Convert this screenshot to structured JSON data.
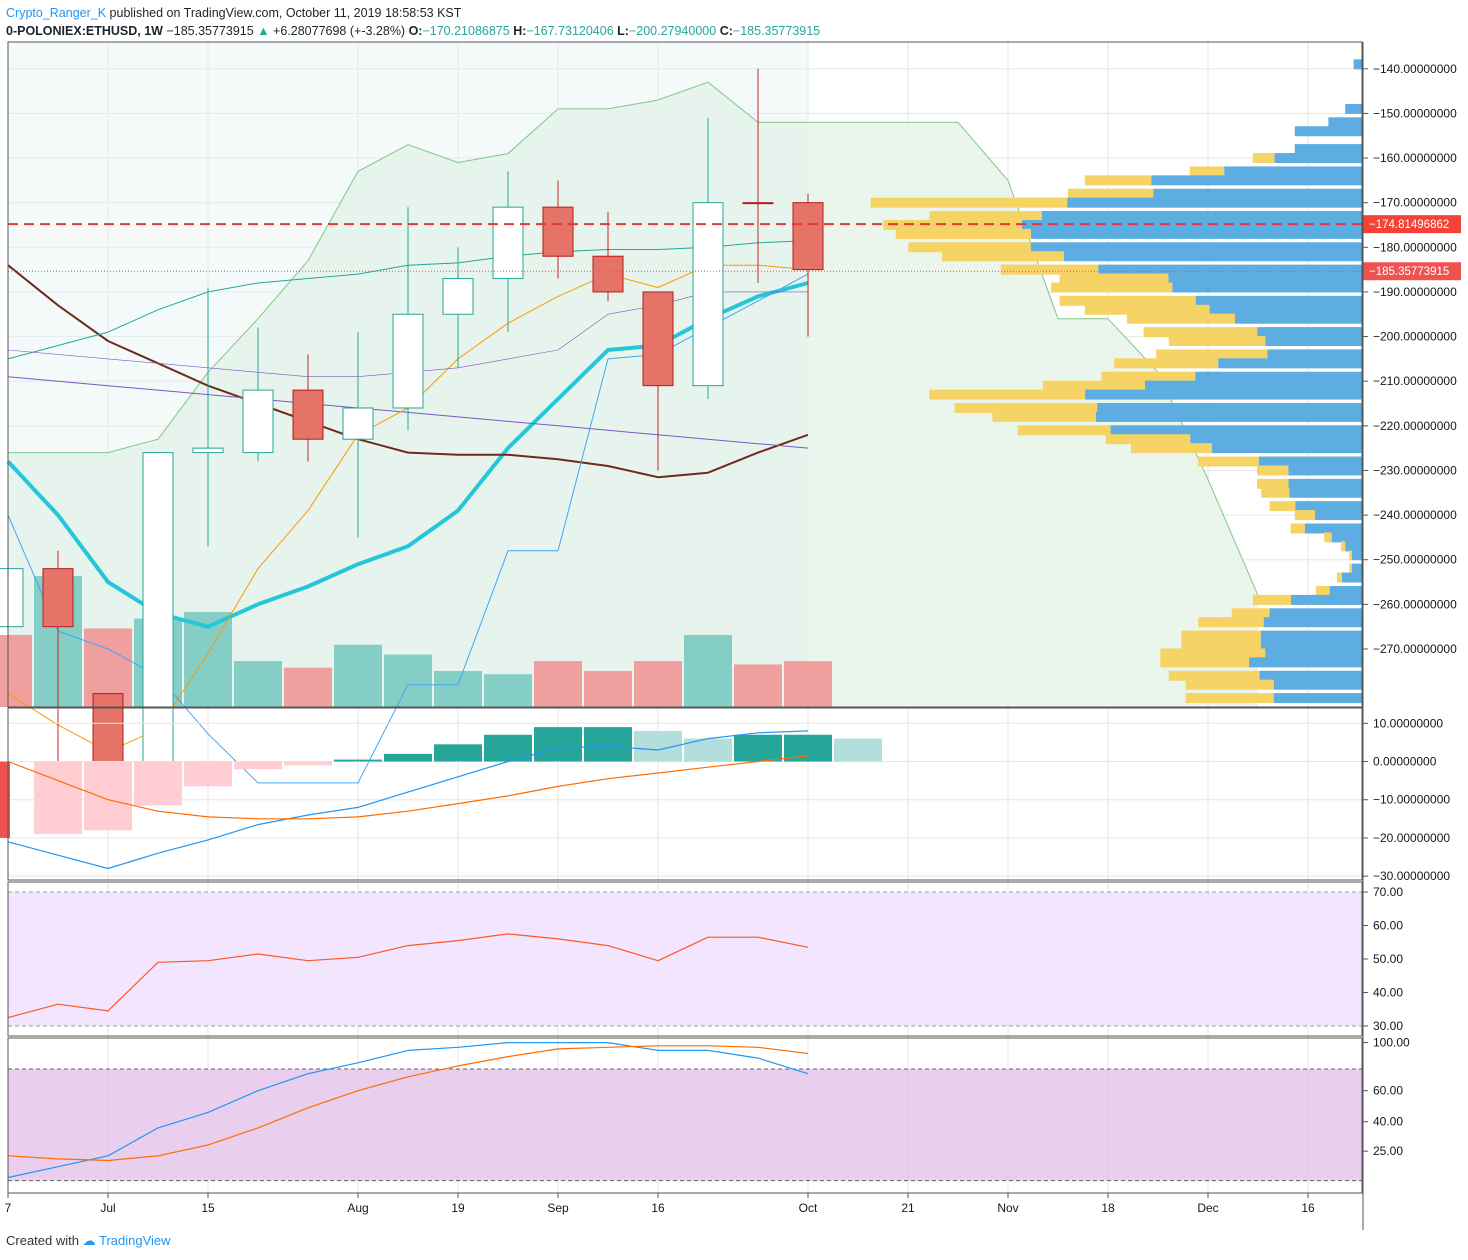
{
  "header": {
    "author": "Crypto_Ranger_K",
    "published": "published on TradingView.com, October 11, 2019 18:58:53 KST",
    "symbol": "0-POLONIEX:ETHUSD, 1W",
    "last": "−185.35773915",
    "change_arrow": "▲",
    "change": "+6.28077698 (+-3.28%)",
    "o_label": "O:",
    "o_val": "−170.21086875",
    "h_label": "H:",
    "h_val": "−167.73120406",
    "l_label": "L:",
    "l_val": "−200.27940000",
    "c_label": "C:",
    "c_val": "−185.35773915"
  },
  "footer": {
    "created_with": "Created with",
    "brand": "TradingView"
  },
  "colors": {
    "up": "#26a69a",
    "down": "#ef5350",
    "ema": "#26c6da",
    "grid": "#e6e6e6"
  },
  "chart_data": [
    {
      "type": "candlestick",
      "panel": "price",
      "x_ticks": [
        "7",
        "Jul",
        "15",
        "Aug",
        "19",
        "Sep",
        "16",
        "Oct",
        "21",
        "Nov",
        "18",
        "Dec",
        "16"
      ],
      "y_ticks": [
        "−140.00000000",
        "−150.00000000",
        "−160.00000000",
        "−170.00000000",
        "−180.00000000",
        "−190.00000000",
        "−200.00000000",
        "−210.00000000",
        "−220.00000000",
        "−230.00000000",
        "−240.00000000",
        "−250.00000000",
        "−260.00000000",
        "−270.00000000"
      ],
      "ylim": [
        -283,
        -134
      ],
      "candles": [
        {
          "o": -265,
          "h": -276,
          "l": -300,
          "c": -252
        },
        {
          "o": -252,
          "h": -248,
          "l": -300,
          "c": -265
        },
        {
          "o": -280,
          "h": -280,
          "l": -300,
          "c": -300
        },
        {
          "o": -297,
          "h": -252,
          "l": -300,
          "c": -226
        },
        {
          "o": -226,
          "h": -189,
          "l": -247,
          "c": -225
        },
        {
          "o": -226,
          "h": -198,
          "l": -228,
          "c": -212
        },
        {
          "o": -212,
          "h": -204,
          "l": -228,
          "c": -223
        },
        {
          "o": -223,
          "h": -199,
          "l": -245,
          "c": -216
        },
        {
          "o": -216,
          "h": -171,
          "l": -221,
          "c": -195
        },
        {
          "o": -195,
          "h": -180,
          "l": -207,
          "c": -187
        },
        {
          "o": -187,
          "h": -163,
          "l": -199,
          "c": -171
        },
        {
          "o": -171,
          "h": -165,
          "l": -187,
          "c": -182
        },
        {
          "o": -182,
          "h": -172,
          "l": -192,
          "c": -190
        },
        {
          "o": -190,
          "h": -190,
          "l": -230,
          "c": -211
        },
        {
          "o": -211,
          "h": -151,
          "l": -214,
          "c": -170
        },
        {
          "o": -170,
          "h": -140,
          "l": -188,
          "c": -170
        },
        {
          "o": -170,
          "h": -168,
          "l": -200,
          "c": -185
        }
      ],
      "horizontal_lines": [
        {
          "value": -174.81496862,
          "label": "−174.81496862",
          "style": "dashed",
          "color": "#e53935"
        },
        {
          "value": -185.35773915,
          "label": "−185.35773915",
          "style": "dotted",
          "color": "#ef5350"
        }
      ],
      "series": [
        {
          "color": "#26c6da",
          "values": [
            -228,
            -240,
            -255,
            -262,
            -265,
            -260,
            -256,
            -251,
            -247,
            -239,
            -225,
            -214,
            -203,
            -202,
            -196,
            -191,
            -188
          ]
        },
        {
          "color": "#6d2b1e",
          "values": [
            -184,
            -193,
            -201,
            -206,
            -211,
            -215,
            -219,
            -223,
            -226,
            -226.5,
            -226.5,
            -227.5,
            -229,
            -231.5,
            -230.5,
            -226,
            -222
          ]
        },
        {
          "color": "#7e57c2",
          "values": [
            -209,
            -210,
            -211,
            -212,
            -213,
            -214,
            -215,
            -216,
            -217,
            -218,
            -219,
            -220,
            -221,
            -222,
            -223,
            -224,
            -225
          ]
        },
        {
          "color": "#ff9800",
          "values": [
            -280,
            -287,
            -293,
            -288,
            -271,
            -252,
            -239,
            -222,
            -216,
            -205,
            -197,
            -191,
            -186,
            -189,
            -184,
            -184,
            -185
          ]
        },
        {
          "color": "#26a69a",
          "values": [
            -205,
            -202,
            -199,
            -194,
            -190,
            -188,
            -187,
            -186,
            -184,
            -183.5,
            -182,
            -181,
            -180.5,
            -180.5,
            -180,
            -179,
            -178.5
          ]
        },
        {
          "color": "#42a5f5",
          "values": [
            -240,
            -266,
            -270,
            -276,
            -289,
            -300,
            -300,
            -300,
            -278,
            -278,
            -248,
            -248,
            -205,
            -204,
            -198,
            -192,
            -186
          ]
        }
      ],
      "volume": [
        {
          "v": 0.22,
          "up": false
        },
        {
          "v": 0.4,
          "up": true
        },
        {
          "v": 0.24,
          "up": false
        },
        {
          "v": 0.27,
          "up": true
        },
        {
          "v": 0.29,
          "up": true
        },
        {
          "v": 0.14,
          "up": true
        },
        {
          "v": 0.12,
          "up": false
        },
        {
          "v": 0.19,
          "up": true
        },
        {
          "v": 0.16,
          "up": true
        },
        {
          "v": 0.11,
          "up": true
        },
        {
          "v": 0.1,
          "up": true
        },
        {
          "v": 0.14,
          "up": false
        },
        {
          "v": 0.11,
          "up": false
        },
        {
          "v": 0.14,
          "up": false
        },
        {
          "v": 0.22,
          "up": true
        },
        {
          "v": 0.13,
          "up": false
        },
        {
          "v": 0.14,
          "up": false
        }
      ],
      "volume_profile": [
        {
          "price": -139,
          "total": 0.02,
          "up_share": 0.0
        },
        {
          "price": -149,
          "total": 0.04,
          "up_share": 0.0
        },
        {
          "price": -152,
          "total": 0.08,
          "up_share": 0.0
        },
        {
          "price": -154,
          "total": 0.16,
          "up_share": 0.0
        },
        {
          "price": -158,
          "total": 0.16,
          "up_share": 0.0
        },
        {
          "price": -160,
          "total": 0.26,
          "up_share": 0.2
        },
        {
          "price": -163,
          "total": 0.41,
          "up_share": 0.2
        },
        {
          "price": -165,
          "total": 0.66,
          "up_share": 0.24
        },
        {
          "price": -168,
          "total": 0.7,
          "up_share": 0.29
        },
        {
          "price": -170,
          "total": 1.17,
          "up_share": 0.4
        },
        {
          "price": -173,
          "total": 1.03,
          "up_share": 0.26
        },
        {
          "price": -175,
          "total": 1.14,
          "up_share": 0.29
        },
        {
          "price": -177,
          "total": 1.11,
          "up_share": 0.29
        },
        {
          "price": -180,
          "total": 1.08,
          "up_share": 0.27
        },
        {
          "price": -182,
          "total": 1.0,
          "up_share": 0.29
        },
        {
          "price": -185,
          "total": 0.86,
          "up_share": 0.27
        },
        {
          "price": -187,
          "total": 0.72,
          "up_share": 0.36
        },
        {
          "price": -189,
          "total": 0.74,
          "up_share": 0.39
        },
        {
          "price": -192,
          "total": 0.72,
          "up_share": 0.45
        },
        {
          "price": -194,
          "total": 0.66,
          "up_share": 0.45
        },
        {
          "price": -196,
          "total": 0.56,
          "up_share": 0.46
        },
        {
          "price": -199,
          "total": 0.52,
          "up_share": 0.52
        },
        {
          "price": -201,
          "total": 0.46,
          "up_share": 0.5
        },
        {
          "price": -204,
          "total": 0.49,
          "up_share": 0.54
        },
        {
          "price": -206,
          "total": 0.59,
          "up_share": 0.42
        },
        {
          "price": -209,
          "total": 0.62,
          "up_share": 0.36
        },
        {
          "price": -211,
          "total": 0.76,
          "up_share": 0.32
        },
        {
          "price": -213,
          "total": 1.03,
          "up_share": 0.36
        },
        {
          "price": -216,
          "total": 0.97,
          "up_share": 0.35
        },
        {
          "price": -218,
          "total": 0.88,
          "up_share": 0.28
        },
        {
          "price": -221,
          "total": 0.82,
          "up_share": 0.27
        },
        {
          "price": -223,
          "total": 0.61,
          "up_share": 0.33
        },
        {
          "price": -225,
          "total": 0.55,
          "up_share": 0.35
        },
        {
          "price": -228,
          "total": 0.39,
          "up_share": 0.37
        },
        {
          "price": -230,
          "total": 0.25,
          "up_share": 0.3
        },
        {
          "price": -233,
          "total": 0.25,
          "up_share": 0.3
        },
        {
          "price": -235,
          "total": 0.24,
          "up_share": 0.28
        },
        {
          "price": -238,
          "total": 0.22,
          "up_share": 0.28
        },
        {
          "price": -240,
          "total": 0.16,
          "up_share": 0.3
        },
        {
          "price": -243,
          "total": 0.17,
          "up_share": 0.2
        },
        {
          "price": -245,
          "total": 0.09,
          "up_share": 0.2
        },
        {
          "price": -247,
          "total": 0.05,
          "up_share": 0.2
        },
        {
          "price": -249,
          "total": 0.03,
          "up_share": 0.2
        },
        {
          "price": -252,
          "total": 0.03,
          "up_share": 0.2
        },
        {
          "price": -254,
          "total": 0.06,
          "up_share": 0.2
        },
        {
          "price": -257,
          "total": 0.11,
          "up_share": 0.3
        },
        {
          "price": -259,
          "total": 0.26,
          "up_share": 0.35
        },
        {
          "price": -262,
          "total": 0.31,
          "up_share": 0.29
        },
        {
          "price": -264,
          "total": 0.39,
          "up_share": 0.4
        },
        {
          "price": -267,
          "total": 0.43,
          "up_share": 0.44
        },
        {
          "price": -269,
          "total": 0.43,
          "up_share": 0.44
        },
        {
          "price": -271,
          "total": 0.48,
          "up_share": 0.52
        },
        {
          "price": -273,
          "total": 0.48,
          "up_share": 0.44
        },
        {
          "price": -276,
          "total": 0.46,
          "up_share": 0.47
        },
        {
          "price": -278,
          "total": 0.42,
          "up_share": 0.5
        },
        {
          "price": -281,
          "total": 0.42,
          "up_share": 0.5
        }
      ]
    },
    {
      "type": "bar",
      "panel": "macd",
      "y_ticks": [
        "10.00000000",
        "0.00000000",
        "−10.00000000",
        "−20.00000000",
        "−30.00000000"
      ],
      "ylim": [
        -31,
        14
      ],
      "histogram": [
        -20,
        -19,
        -18,
        -11.5,
        -6.5,
        -2,
        -1,
        0.5,
        2,
        4.5,
        7,
        9,
        9,
        8,
        6,
        7,
        7,
        6
      ],
      "series": [
        {
          "color": "#2196f3",
          "values": [
            -21,
            -24.5,
            -28,
            -24,
            -20.5,
            -16.5,
            -14,
            -12,
            -8,
            -4,
            0,
            3.5,
            4,
            3,
            6,
            7.5,
            8
          ]
        },
        {
          "color": "#ff6d00",
          "values": [
            0,
            -5,
            -10,
            -13,
            -14.5,
            -15,
            -15,
            -14.5,
            -13,
            -11,
            -9,
            -6.5,
            -4.5,
            -3,
            -1.5,
            0,
            1.5
          ]
        }
      ]
    },
    {
      "type": "line",
      "panel": "rsi",
      "y_ticks": [
        "70.00",
        "60.00",
        "50.00",
        "40.00",
        "30.00"
      ],
      "ylim": [
        27,
        73
      ],
      "band": [
        30,
        70
      ],
      "values": [
        32.5,
        36.5,
        34.5,
        49,
        49.5,
        51.5,
        49.5,
        50.5,
        54,
        55.5,
        57.5,
        56,
        54,
        49.5,
        56.5,
        56.5,
        53.5
      ]
    },
    {
      "type": "line",
      "panel": "stoch",
      "y_ticks": [
        "100.00",
        "60.00",
        "40.00",
        "25.00"
      ],
      "ylim": [
        6,
        106
      ],
      "band": [
        14,
        86
      ],
      "series": [
        {
          "color": "#2196f3",
          "values": [
            16,
            23,
            30,
            48,
            58,
            72,
            83,
            90,
            98,
            100,
            103,
            103,
            103,
            98,
            98,
            93,
            83
          ]
        },
        {
          "color": "#ff6d00",
          "values": [
            30,
            28,
            27,
            30,
            37,
            48,
            61,
            72,
            81,
            88,
            94,
            99,
            100,
            101,
            101,
            100,
            96
          ]
        }
      ]
    }
  ]
}
